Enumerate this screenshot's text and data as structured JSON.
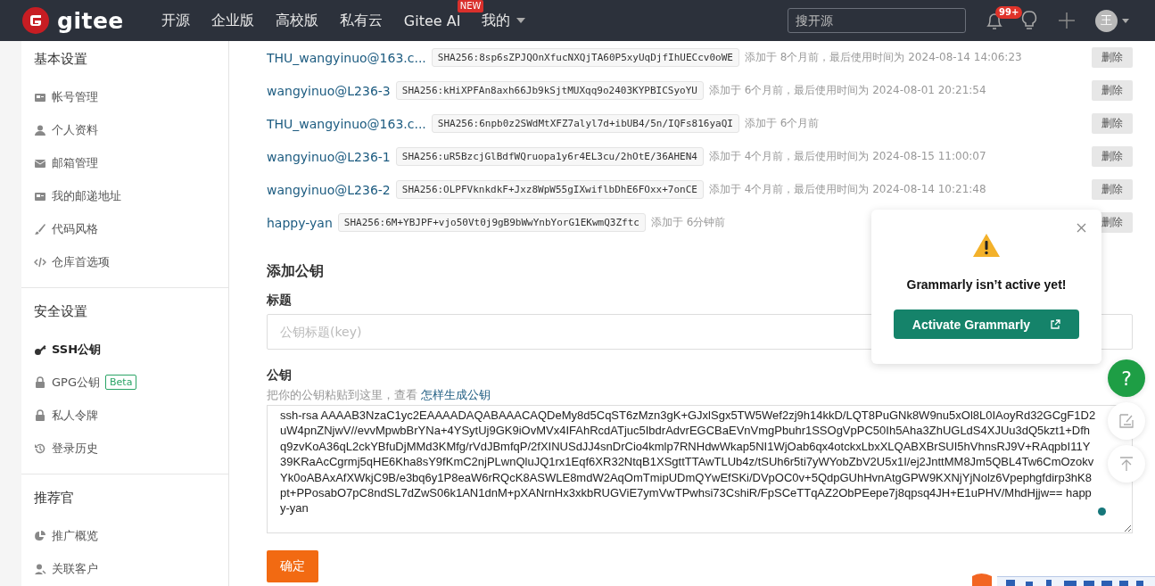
{
  "header": {
    "logo_text": "gitee",
    "nav": [
      {
        "label": "开源"
      },
      {
        "label": "企业版"
      },
      {
        "label": "高校版"
      },
      {
        "label": "私有云"
      },
      {
        "label": "Gitee AI",
        "badge": "NEW"
      },
      {
        "label": "我的",
        "dropdown": true
      }
    ],
    "search": {
      "placeholder": "搜开源"
    },
    "notifications": {
      "badge": "99+"
    },
    "avatar": {
      "initial": "王"
    }
  },
  "sidebar": {
    "sections": [
      {
        "title": "基本设置",
        "items": [
          {
            "label": "帐号管理",
            "kind": "card",
            "selected": false
          },
          {
            "label": "个人资料",
            "kind": "user",
            "selected": false
          },
          {
            "label": "邮箱管理",
            "kind": "envelope",
            "selected": false
          },
          {
            "label": "我的邮递地址",
            "kind": "card",
            "selected": false
          },
          {
            "label": "代码风格",
            "kind": "brush",
            "selected": false
          },
          {
            "label": "仓库首选项",
            "kind": "code",
            "selected": false
          }
        ]
      },
      {
        "title": "安全设置",
        "items": [
          {
            "label": "SSH公钥",
            "kind": "key",
            "selected": true
          },
          {
            "label": "GPG公钥",
            "kind": "lock",
            "badge": "Beta",
            "selected": false
          },
          {
            "label": "私人令牌",
            "kind": "lock",
            "selected": false
          },
          {
            "label": "登录历史",
            "kind": "history",
            "selected": false
          }
        ]
      },
      {
        "title": "推荐官",
        "items": [
          {
            "label": "推广概览",
            "kind": "pie",
            "selected": false
          },
          {
            "label": "关联客户",
            "kind": "contact",
            "selected": false
          }
        ]
      }
    ]
  },
  "ssh_keys": [
    {
      "name": "THU_wangyinuo@163.c...",
      "fingerprint": "SHA256:8sp6sZPJQOnXfucNXQjTA60P5xyUqDjfIhUECcv0oWE",
      "meta": "添加于 8个月前，最后使用时间为 2024-08-14 14:06:23",
      "delete_label": "删除"
    },
    {
      "name": "wangyinuo@L236-3",
      "fingerprint": "SHA256:kHiXPFAn8axh66Jb9kSjtMUXqq9o2403KYPBICSyoYU",
      "meta": "添加于 6个月前，最后使用时间为 2024-08-01 20:21:54",
      "delete_label": "删除"
    },
    {
      "name": "THU_wangyinuo@163.c...",
      "fingerprint": "SHA256:6npb0z2SWdMtXFZ7alyl7d+ibUB4/5n/IQFs816yaQI",
      "meta": "添加于 6个月前",
      "delete_label": "删除"
    },
    {
      "name": "wangyinuo@L236-1",
      "fingerprint": "SHA256:uR5BzcjGlBdfWQruopa1y6r4EL3cu/2hOtE/36AHEN4",
      "meta": "添加于 4个月前，最后使用时间为 2024-08-15 11:00:07",
      "delete_label": "删除"
    },
    {
      "name": "wangyinuo@L236-2",
      "fingerprint": "SHA256:OLPFVknkdkF+Jxz8WpW55gIXwiflbDhE6FOxx+7onCE",
      "meta": "添加于 4个月前，最后使用时间为 2024-08-14 10:21:48",
      "delete_label": "删除"
    },
    {
      "name": "happy-yan",
      "fingerprint": "SHA256:6M+YBJPF+vjo50Vt0j9gB9bWwYnbYorG1EKwmQ3Zftc",
      "meta": "添加于 6分钟前",
      "delete_label": "删除"
    }
  ],
  "add_key": {
    "heading": "添加公钥",
    "title_label": "标题",
    "title_placeholder": "公钥标题(key)",
    "key_label": "公钥",
    "hint": "把你的公钥粘贴到这里，查看 ",
    "hint_link": "怎样生成公钥",
    "key_value": "ssh-rsa AAAAB3NzaC1yc2EAAAADAQABAAACAQDeMy8d5CqST6zMzn3gK+GJxlSgx5TW5Wef2zj9h14kkD/LQT8PuGNk8W9nu5xOl8L0IAoyRd32GCgF1D2uW4pnZNjwV//evvMpwbBrYNa+4YSytUj9GK9iOvMVx4IFAhRcdATjuc5IbdrAdvrEGCBaEVnVmgPbuhr1SSOgVpPC50Ih5Aha3ZhUGLdS4XJUu3dQ5kzt1+Dfhq9zvKoA36qL2ckYBfuDjMMd3KMfg/rVdJBmfqP/2fXINUSdJJ4snDrCio4kmlp7RNHdwWkap5NI1WjOab6qx4otckxLbxXLQABXBrSUI5hVhnsRJ9V+RAqpbI11Y39KRaAcCgrmj5qHE6Kha8sY9fKmC2njPLwnQluJQ1rx1Eqf6XR32NtqB1XSgttTTAwTLUb4z/tSUh6r5ti7yWYobZbV2U5x1I/ej2JnttMM8Jm5QBL4Tw6CmOzokvYk0oABAxAfXWkjC9B/e3bq6y1P8eaW6rRQcK8ASWLE8mdW2AqOmTmipUDmQYwEfSKi/DVpOC0v+5QdpGUhHvnAtgGPW9KXNjYjNolz6Vpephgfdirp3hK8pt+PPosabO7pC8ndSL7dZwS06k1AN1dnM+pXANrnHx3xkbRUGViE7ymVwTPwhsi73CshiR/FpSCeTTqAZ2ObPEepe7j8qpsq4JH+E1uPHV/MhdHjjw== happy-yan",
    "submit": "确定"
  },
  "grammarly_popup": {
    "message": "Grammarly isn’t active yet!",
    "button": "Activate Grammarly"
  },
  "floating_buttons": [
    {
      "kind": "help",
      "label": "?"
    },
    {
      "kind": "edit"
    },
    {
      "kind": "top"
    }
  ]
}
